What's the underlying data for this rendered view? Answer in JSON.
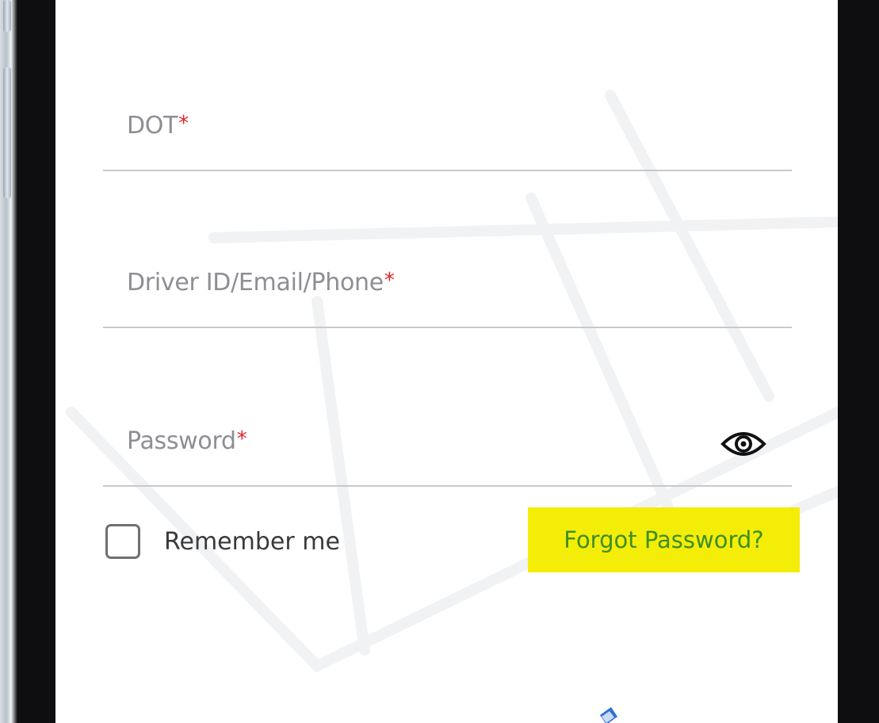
{
  "form": {
    "dot_label": "DOT",
    "driver_label": "Driver ID/Email/Phone",
    "password_label": "Password",
    "required_mark": "*",
    "remember_label": "Remember me",
    "forgot_label": "Forgot Password?"
  },
  "icons": {
    "password_toggle": "eye-icon",
    "checkbox": "checkbox-unchecked"
  },
  "colors": {
    "required": "#e0242c",
    "forgot_text": "#3c8f23",
    "forgot_highlight": "#f4ed08"
  }
}
